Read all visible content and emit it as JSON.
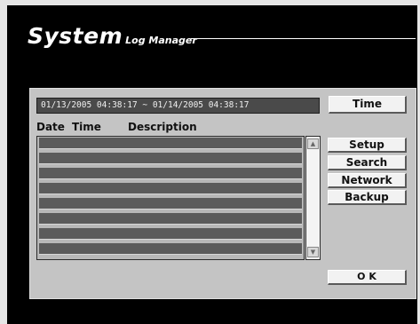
{
  "header": {
    "title_main": "System",
    "title_sub": "Log Manager"
  },
  "range": {
    "value": "01/13/2005  04:38:17 ~ 01/14/2005  04:38:17"
  },
  "buttons": {
    "time": "Time",
    "setup": "Setup",
    "search": "Search",
    "network": "Network",
    "backup": "Backup",
    "ok": "O K"
  },
  "columns": {
    "date": "Date",
    "time": "Time",
    "description": "Description"
  },
  "log_rows": [
    {
      "date": "",
      "time": "",
      "description": ""
    },
    {
      "date": "",
      "time": "",
      "description": ""
    },
    {
      "date": "",
      "time": "",
      "description": ""
    },
    {
      "date": "",
      "time": "",
      "description": ""
    },
    {
      "date": "",
      "time": "",
      "description": ""
    },
    {
      "date": "",
      "time": "",
      "description": ""
    },
    {
      "date": "",
      "time": "",
      "description": ""
    },
    {
      "date": "",
      "time": "",
      "description": ""
    }
  ],
  "scrollbar": {
    "up_icon": "triangle-up",
    "down_icon": "triangle-down"
  },
  "colors": {
    "background": "#000000",
    "panel": "#c4c4c4",
    "row": "#5b5b5b",
    "field": "#4a4a4a",
    "button": "#f2f2f2"
  }
}
